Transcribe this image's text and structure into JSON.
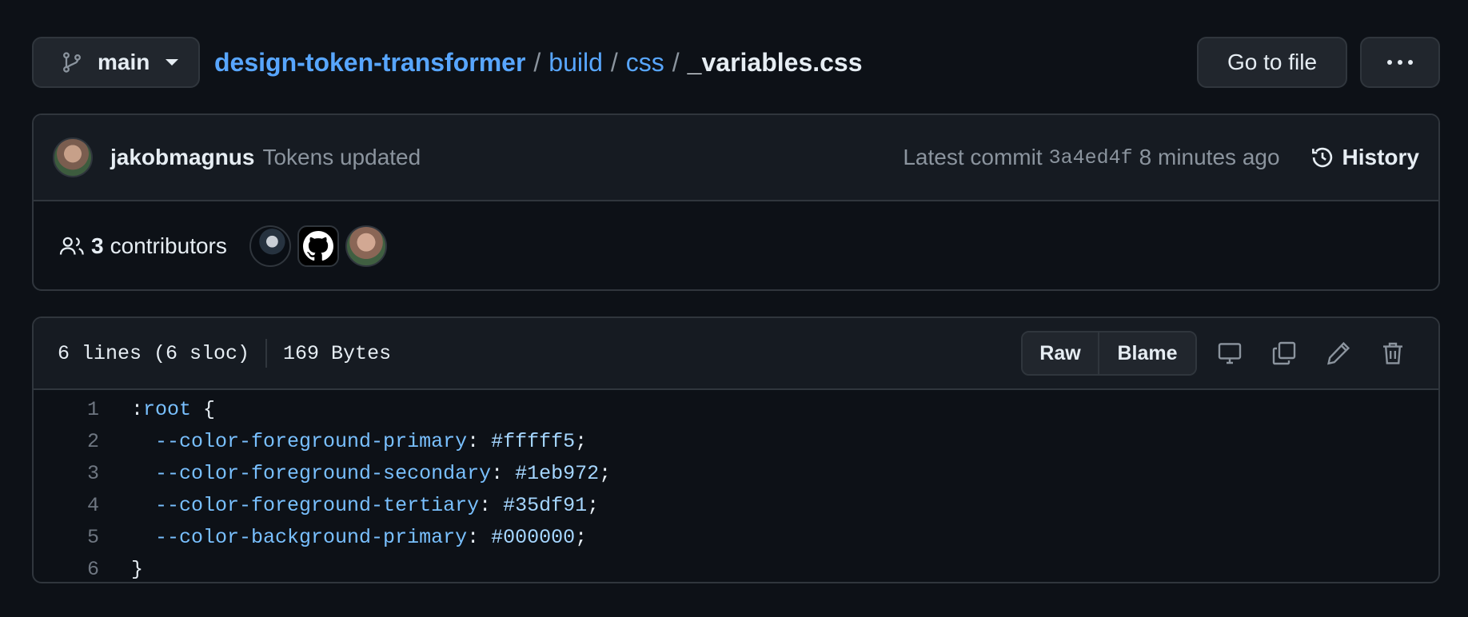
{
  "branch": {
    "name": "main",
    "icon": "git-branch-icon"
  },
  "breadcrumb": {
    "repo": "design-token-transformer",
    "dir1": "build",
    "dir2": "css",
    "file": "_variables.css",
    "separator": "/"
  },
  "actions": {
    "go_to_file": "Go to file",
    "more_icon": "kebab-horizontal-icon"
  },
  "commit": {
    "author": "jakobmagnus",
    "message": "Tokens updated",
    "latest_label": "Latest commit",
    "sha": "3a4ed4f",
    "time": "8 minutes ago",
    "history_label": "History"
  },
  "contributors": {
    "count": "3",
    "label": "contributors"
  },
  "file": {
    "lines_info": "6 lines (6 sloc)",
    "size": "169 Bytes",
    "raw_label": "Raw",
    "blame_label": "Blame",
    "lines": [
      {
        "n": "1",
        "sel": ":root",
        "rest": " {"
      },
      {
        "n": "2",
        "prop": "--color-foreground-primary",
        "val": "#fffff5"
      },
      {
        "n": "3",
        "prop": "--color-foreground-secondary",
        "val": "#1eb972"
      },
      {
        "n": "4",
        "prop": "--color-foreground-tertiary",
        "val": "#35df91"
      },
      {
        "n": "5",
        "prop": "--color-background-primary",
        "val": "#000000"
      },
      {
        "n": "6",
        "sel": "}",
        "rest": ""
      }
    ]
  },
  "colors": {
    "background": "#0d1117",
    "panel": "#161b22",
    "border": "#30363d",
    "link": "#58a6ff",
    "muted": "#8b949e",
    "code_keyword": "#79c0ff"
  }
}
